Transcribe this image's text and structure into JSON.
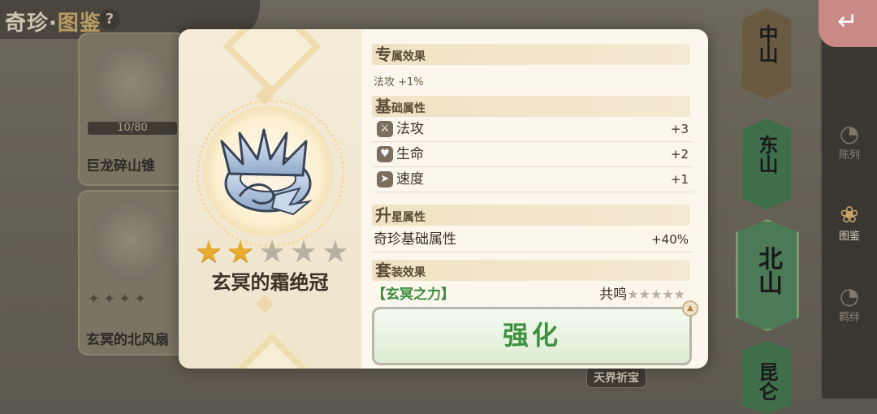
{
  "background": {
    "title_part1": "奇珍·",
    "title_part2": "图鉴",
    "help_icon": "?",
    "cards": [
      {
        "name": "巨龙碎山锥",
        "progress": "10/80"
      },
      {
        "name": "玄冥的北风扇"
      }
    ],
    "regions": [
      "中山",
      "东山",
      "北山",
      "昆仑"
    ],
    "side_nav": [
      {
        "label": "陈列",
        "icon": "swirl-icon"
      },
      {
        "label": "图鉴",
        "icon": "lotus-icon",
        "active": true
      },
      {
        "label": "羁绊",
        "icon": "swirl-icon"
      }
    ],
    "bottom_tag": "天界祈宝",
    "back_icon": "return-arrow-icon"
  },
  "item": {
    "name": "玄冥的霜绝冠",
    "stars_total": 5,
    "stars_lit": 2,
    "icon": "frost-crown-icon"
  },
  "details": {
    "exclusive": {
      "head_big": "专",
      "head_rest": "属效果",
      "text": "法攻 +1%"
    },
    "base": {
      "head_big": "基",
      "head_rest": "础属性",
      "stats": [
        {
          "label": "法攻",
          "value": "+3",
          "icon": "sword-icon"
        },
        {
          "label": "生命",
          "value": "+2",
          "icon": "heart-icon"
        },
        {
          "label": "速度",
          "value": "+1",
          "icon": "boot-icon"
        }
      ]
    },
    "star_up": {
      "head_big": "升",
      "head_rest": "星属性",
      "label": "奇珍基础属性",
      "value": "+40%"
    },
    "set": {
      "head_big": "套",
      "head_rest": "装效果",
      "name": "【玄冥之力】",
      "resonance_label": "共鸣",
      "resonance_stars": "★★★★★"
    }
  },
  "enhance_button": "强化"
}
